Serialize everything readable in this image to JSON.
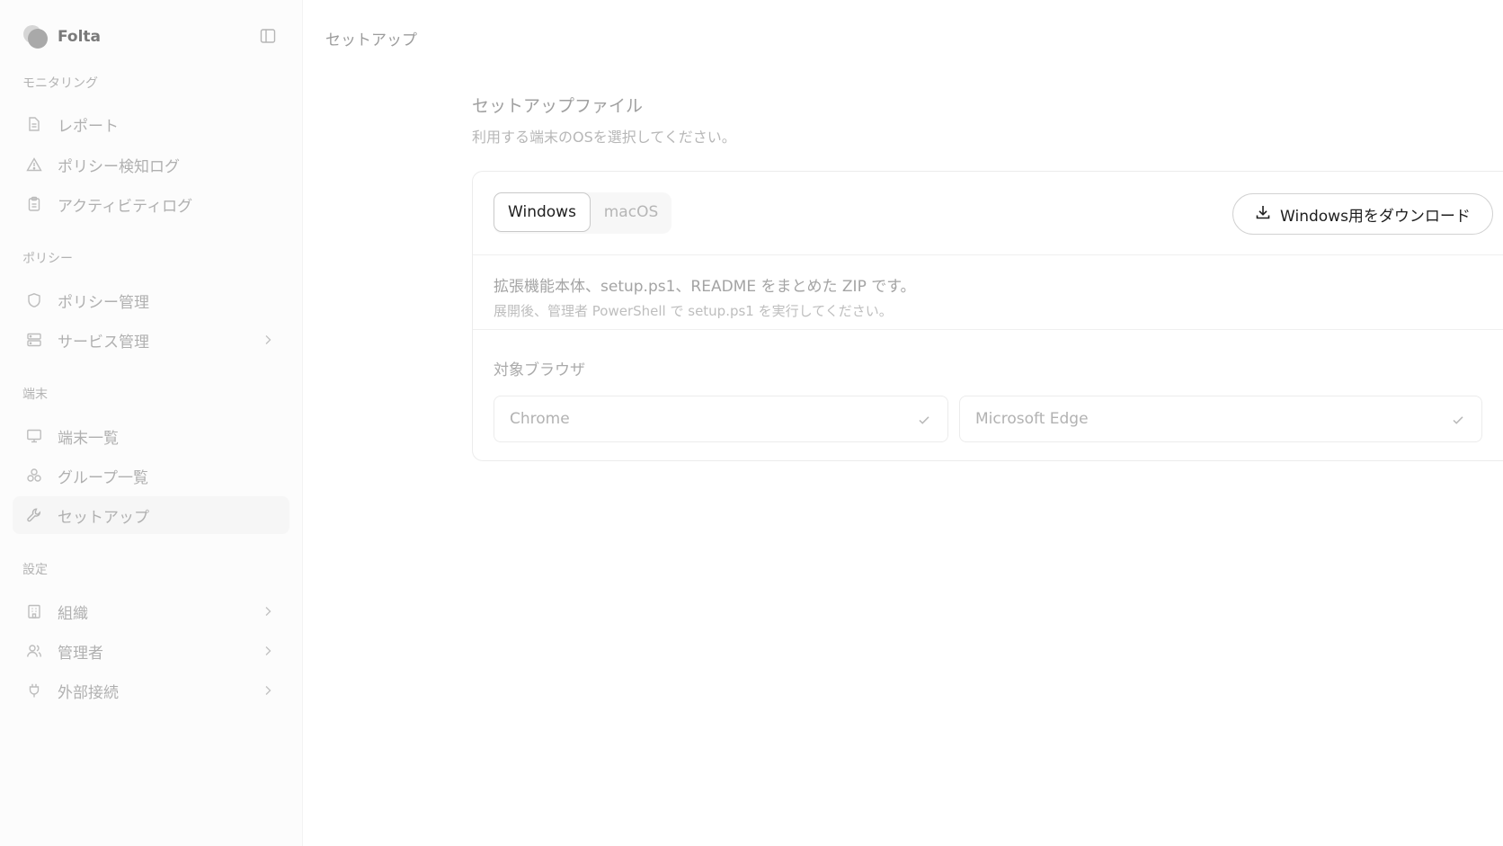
{
  "app": {
    "name": "Folta"
  },
  "sidebar": {
    "sections": [
      {
        "label": "モニタリング",
        "items": [
          {
            "label": "レポート",
            "icon": "file-text-icon",
            "has_chevron": false,
            "active": false
          },
          {
            "label": "ポリシー検知ログ",
            "icon": "alert-triangle-icon",
            "has_chevron": false,
            "active": false
          },
          {
            "label": "アクティビティログ",
            "icon": "clipboard-icon",
            "has_chevron": false,
            "active": false
          }
        ]
      },
      {
        "label": "ポリシー",
        "items": [
          {
            "label": "ポリシー管理",
            "icon": "shield-icon",
            "has_chevron": false,
            "active": false
          },
          {
            "label": "サービス管理",
            "icon": "server-icon",
            "has_chevron": true,
            "active": false
          }
        ]
      },
      {
        "label": "端末",
        "items": [
          {
            "label": "端末一覧",
            "icon": "monitor-icon",
            "has_chevron": false,
            "active": false
          },
          {
            "label": "グループ一覧",
            "icon": "group-icon",
            "has_chevron": false,
            "active": false
          },
          {
            "label": "セットアップ",
            "icon": "wrench-icon",
            "has_chevron": false,
            "active": true
          }
        ]
      },
      {
        "label": "設定",
        "items": [
          {
            "label": "組織",
            "icon": "building-icon",
            "has_chevron": true,
            "active": false
          },
          {
            "label": "管理者",
            "icon": "users-icon",
            "has_chevron": true,
            "active": false
          },
          {
            "label": "外部接続",
            "icon": "plug-icon",
            "has_chevron": true,
            "active": false
          }
        ]
      }
    ]
  },
  "header": {
    "breadcrumb": "セットアップ"
  },
  "main": {
    "title": "セットアップファイル",
    "description": "利用する端末のOSを選択してください。",
    "os_tabs": [
      {
        "label": "Windows",
        "selected": true
      },
      {
        "label": "macOS",
        "selected": false
      }
    ],
    "download_label": "Windows用をダウンロード",
    "info_main": "拡張機能本体、setup.ps1、README をまとめた ZIP です。",
    "info_sub": "展開後、管理者 PowerShell で setup.ps1 を実行してください。",
    "browser_label": "対象ブラウザ",
    "browsers": [
      {
        "label": "Chrome",
        "checked": true
      },
      {
        "label": "Microsoft Edge",
        "checked": true
      }
    ]
  },
  "colors": {
    "active_item_bg": "#f6f6f6",
    "selected_tab_border": "#c9c9c9",
    "muted_text": "#b0b0b0"
  }
}
